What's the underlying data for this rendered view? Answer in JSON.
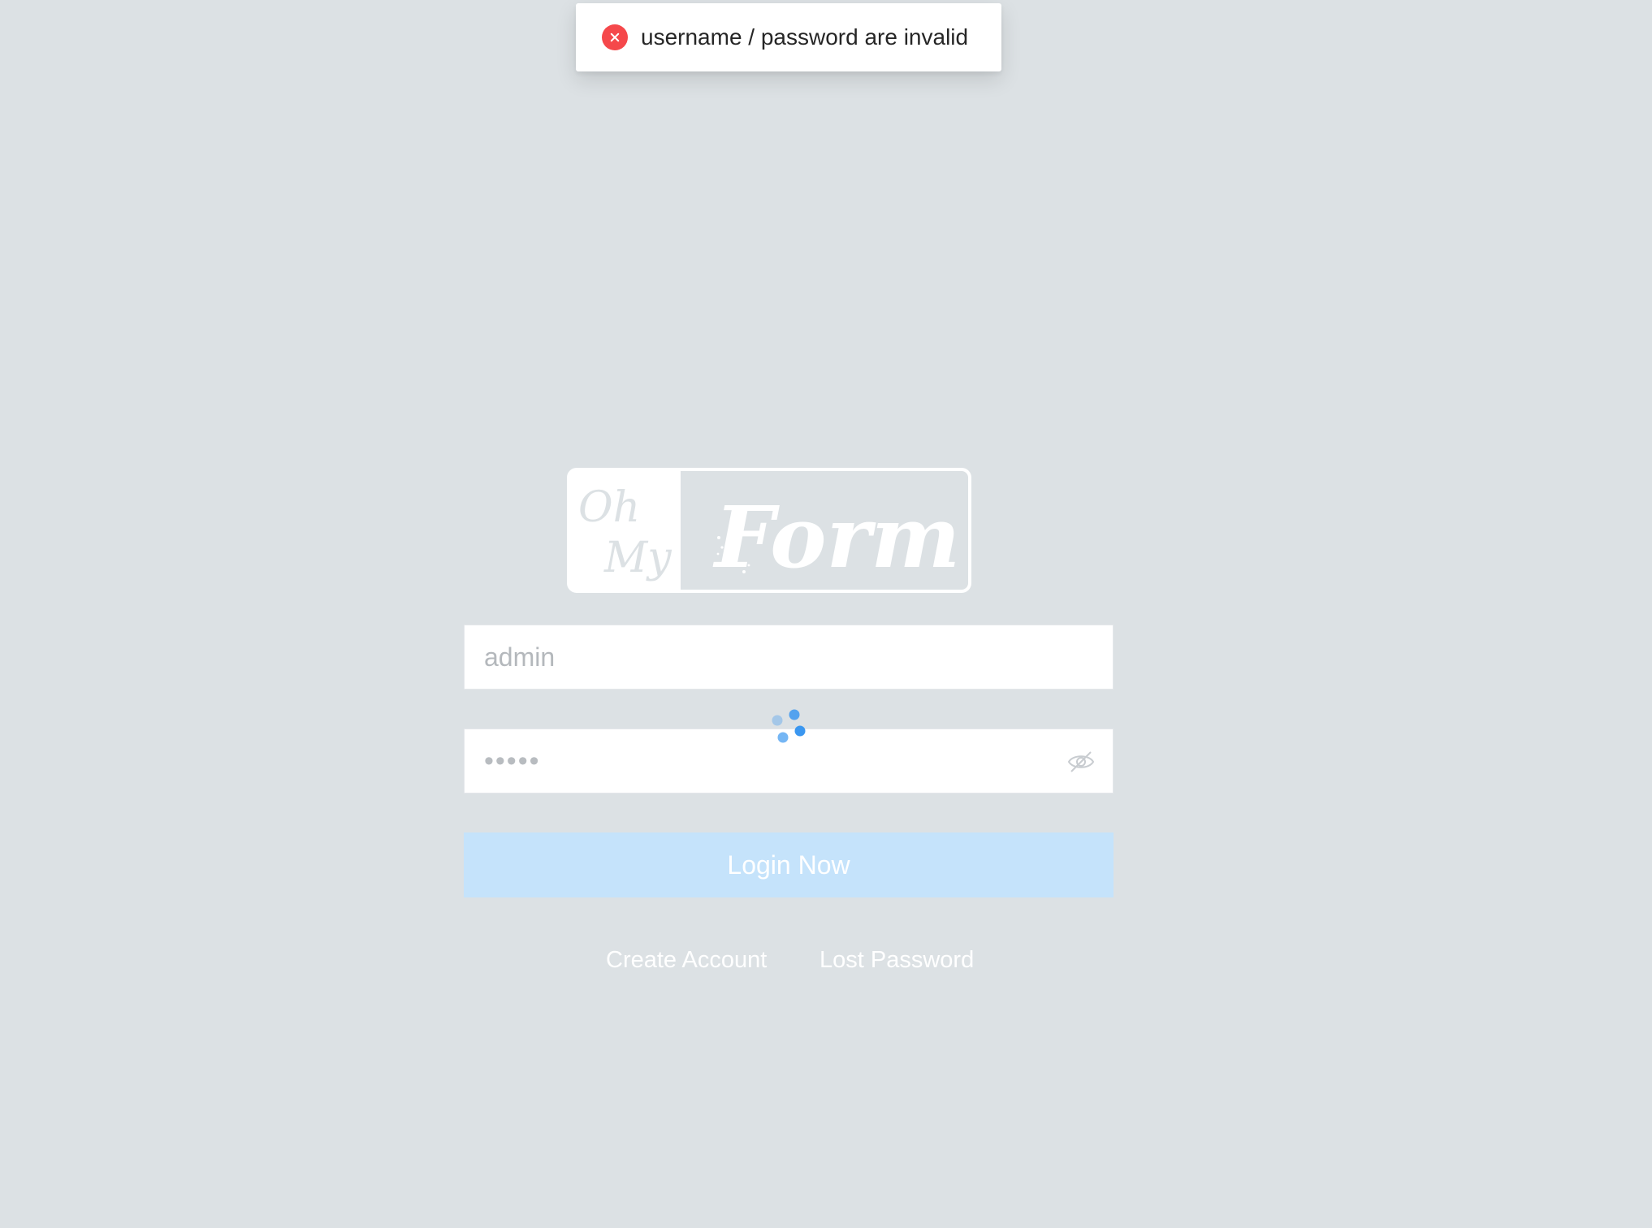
{
  "toast": {
    "icon": "error-circle-icon",
    "message": "username / password are invalid",
    "icon_color": "#f5484b"
  },
  "logo": {
    "text_left_top": "Oh",
    "text_left_bottom": "My",
    "text_right": "Form"
  },
  "form": {
    "username_value": "admin",
    "password_value": "•••••",
    "password_toggle_icon": "eye-off-icon",
    "spinner_icon": "loading-spinner-icon",
    "login_label": "Login Now",
    "login_color": "#c5e3fb"
  },
  "links": {
    "create_account": "Create Account",
    "lost_password": "Lost Password"
  },
  "colors": {
    "background": "#dce1e4",
    "spinner": "#3b97f0"
  }
}
